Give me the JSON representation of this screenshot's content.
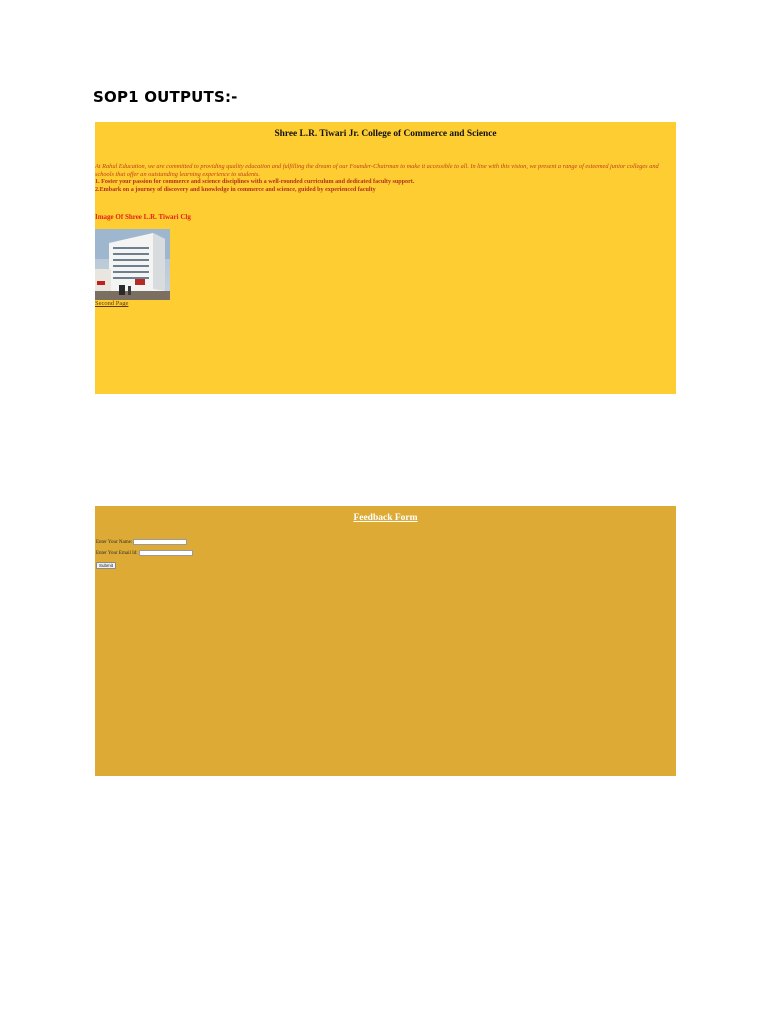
{
  "document": {
    "heading": "SOP1 OUTPUTS:-"
  },
  "output_one": {
    "college_title": "Shree L.R. Tiwari Jr. College of Commerce and Science",
    "intro_text": "At Rahul Education, we are committed to providing quality education and fulfilling the dream of our Founder-Chairman to make it accessible to all. In line with this vision, we present a range of esteemed junior colleges and schools that offer an outstanding learning experience to students.",
    "points": [
      "1. Foster your passion for commerce and science disciplines with a well-rounded curriculum and dedicated faculty support.",
      "2.Embark on a journey of discovery and knowledge in commerce and science, guided by experienced faculty"
    ],
    "image_heading": "Image Of Shree L.R. Tiwari Clg",
    "link_text": "Second Page",
    "colors": {
      "background": "#fdcd31",
      "intro": "#c23f1d",
      "heading": "#e8201a"
    }
  },
  "output_two": {
    "form_title": "Feedback Form",
    "name_label": "Enter Your Name:",
    "email_label": "Enter Your Email Id:",
    "name_value": "",
    "email_value": "",
    "submit_label": "Submit",
    "colors": {
      "background": "#ddab35",
      "title": "#ffffff"
    }
  }
}
